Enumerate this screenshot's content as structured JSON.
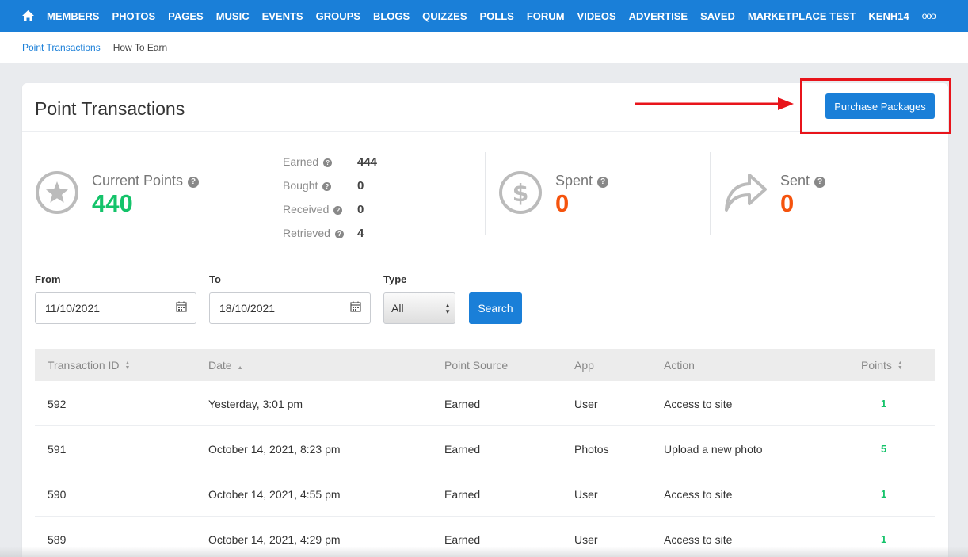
{
  "topnav": {
    "items": [
      "MEMBERS",
      "PHOTOS",
      "PAGES",
      "MUSIC",
      "EVENTS",
      "GROUPS",
      "BLOGS",
      "QUIZZES",
      "POLLS",
      "FORUM",
      "VIDEOS",
      "ADVERTISE",
      "SAVED",
      "MARKETPLACE TEST",
      "KENH14"
    ],
    "more": "ooo",
    "bg_color": "#1a7fd8"
  },
  "subnav": {
    "active": "Point Transactions",
    "other": "How To Earn"
  },
  "card": {
    "title": "Point Transactions",
    "purchase_label": "Purchase Packages"
  },
  "stats": {
    "current_label": "Current Points",
    "current_value": "440",
    "breakdown": [
      {
        "label": "Earned",
        "value": "444"
      },
      {
        "label": "Bought",
        "value": "0"
      },
      {
        "label": "Received",
        "value": "0"
      },
      {
        "label": "Retrieved",
        "value": "4"
      }
    ],
    "spent_label": "Spent",
    "spent_value": "0",
    "sent_label": "Sent",
    "sent_value": "0",
    "help_glyph": "?"
  },
  "filters": {
    "from_label": "From",
    "from_value": "11/10/2021",
    "to_label": "To",
    "to_value": "18/10/2021",
    "type_label": "Type",
    "type_value": "All",
    "search_label": "Search"
  },
  "table": {
    "headers": [
      "Transaction ID",
      "Date",
      "Point Source",
      "App",
      "Action",
      "Points"
    ],
    "rows": [
      {
        "id": "592",
        "date": "Yesterday, 3:01 pm",
        "source": "Earned",
        "app": "User",
        "action": "Access to site",
        "points": "1"
      },
      {
        "id": "591",
        "date": "October 14, 2021, 8:23 pm",
        "source": "Earned",
        "app": "Photos",
        "action": "Upload a new photo",
        "points": "5"
      },
      {
        "id": "590",
        "date": "October 14, 2021, 4:55 pm",
        "source": "Earned",
        "app": "User",
        "action": "Access to site",
        "points": "1"
      },
      {
        "id": "589",
        "date": "October 14, 2021, 4:29 pm",
        "source": "Earned",
        "app": "User",
        "action": "Access to site",
        "points": "1"
      }
    ]
  },
  "colors": {
    "accent": "#1a7fd8",
    "positive": "#14c36a",
    "negative": "#f5530d",
    "highlight": "#e8141b"
  }
}
